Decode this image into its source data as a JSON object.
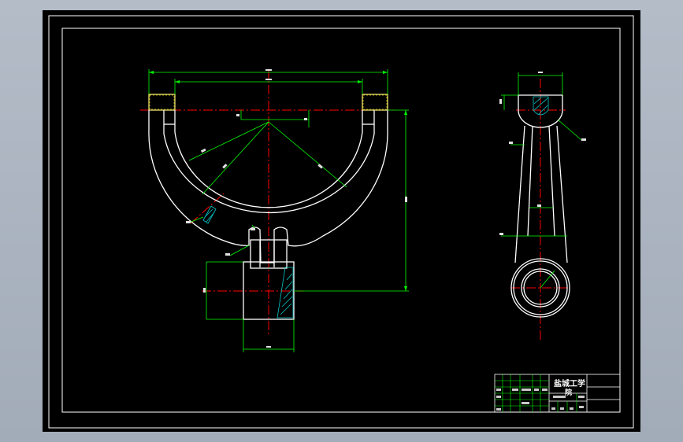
{
  "colors": {
    "viewport_background": "#a9b2be",
    "paper": "#000000",
    "part_outline": "#ffffff",
    "dimension": "#00ff00",
    "center_line": "#ff0000",
    "hatch": "#00c8c8"
  },
  "title_block": {
    "school": "盐城工学",
    "school_second_line": "院"
  }
}
